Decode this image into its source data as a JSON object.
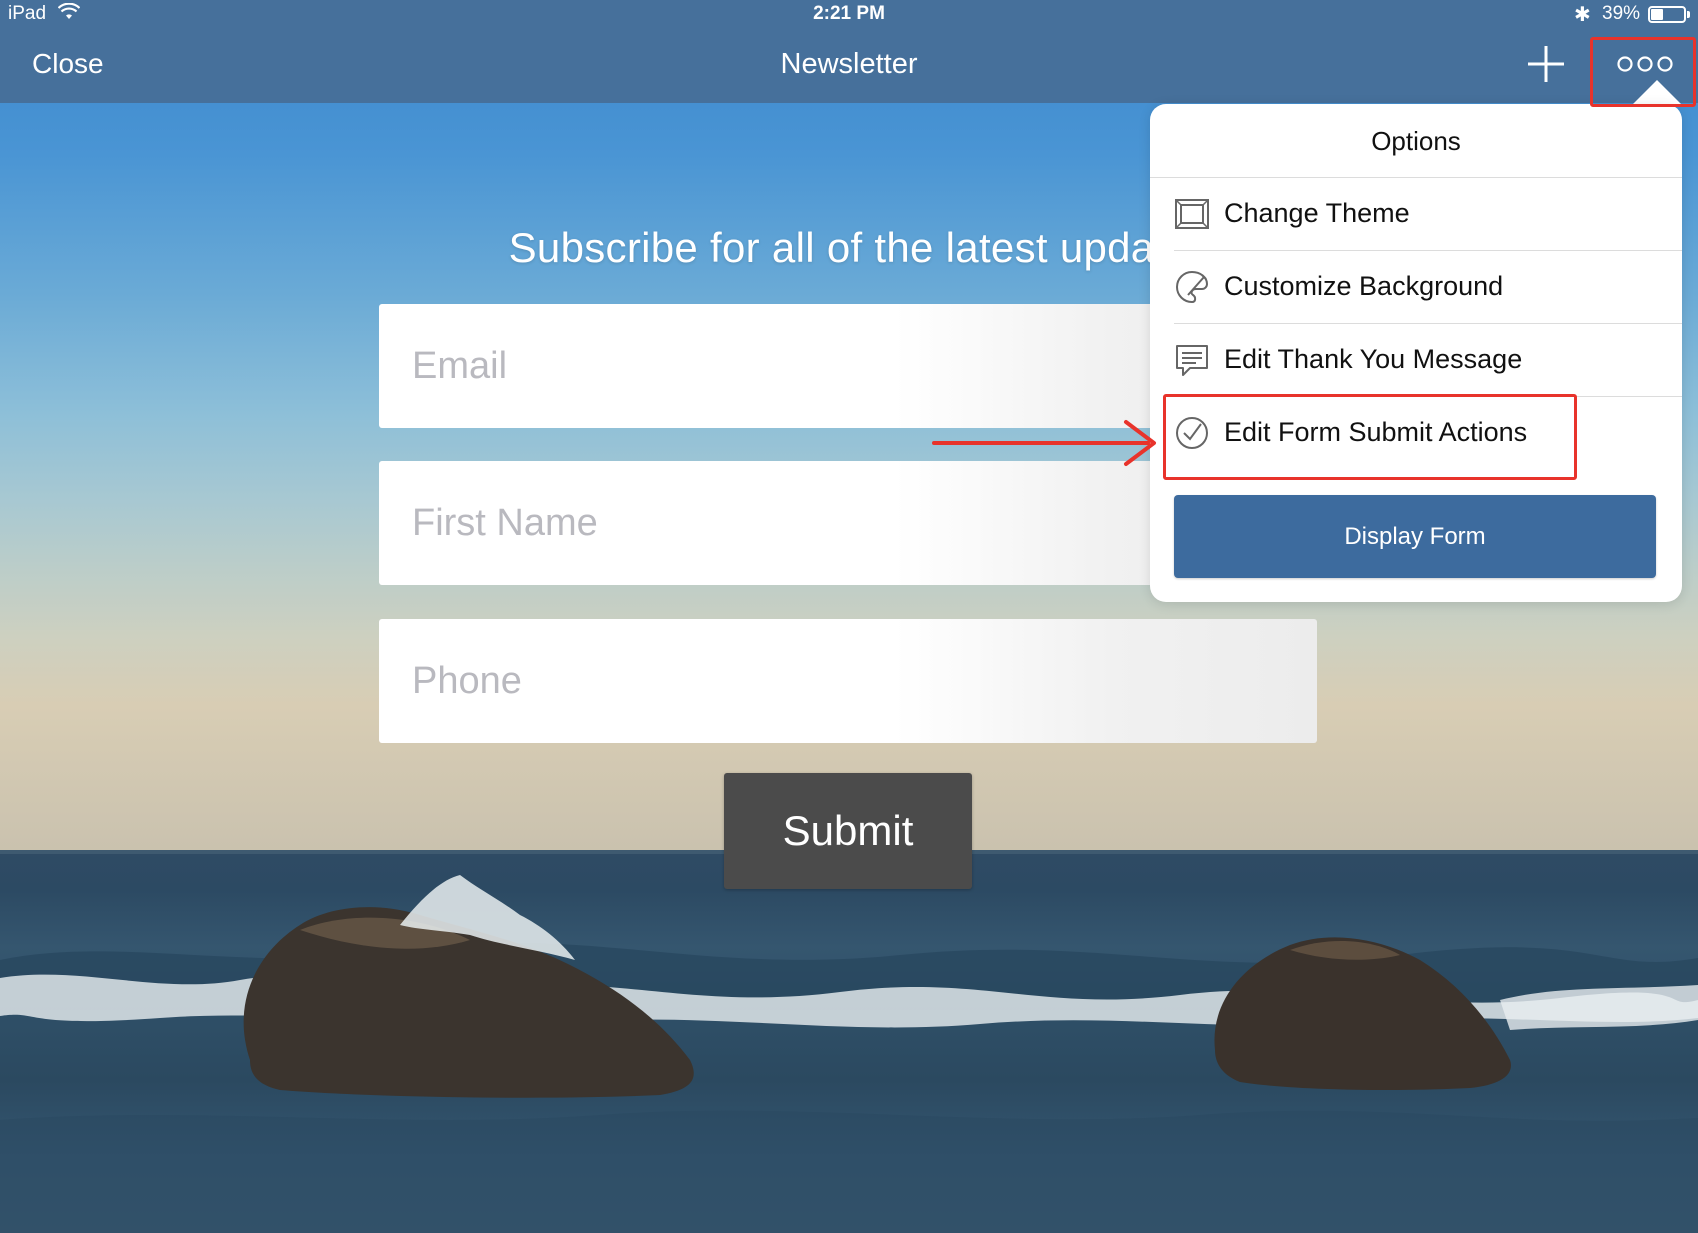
{
  "status_bar": {
    "device": "iPad",
    "time": "2:21 PM",
    "battery_percent": "39%",
    "battery_level": 0.39,
    "icons": [
      "wifi-icon",
      "bluetooth-icon",
      "battery-icon"
    ]
  },
  "nav": {
    "close_label": "Close",
    "title": "Newsletter",
    "add_icon": "plus-icon",
    "more_icon": "more-options-icon"
  },
  "form": {
    "heading": "Subscribe for all of the latest updates",
    "fields": [
      {
        "placeholder": "Email"
      },
      {
        "placeholder": "First Name"
      },
      {
        "placeholder": "Phone"
      }
    ],
    "submit_label": "Submit"
  },
  "options_popover": {
    "title": "Options",
    "items": [
      {
        "label": "Change Theme",
        "icon": "theme-frame-icon"
      },
      {
        "label": "Customize Background",
        "icon": "palette-brush-icon"
      },
      {
        "label": "Edit Thank You Message",
        "icon": "message-bubble-icon"
      },
      {
        "label": "Edit Form Submit Actions",
        "icon": "check-circle-icon"
      }
    ],
    "display_form_label": "Display Form"
  },
  "colors": {
    "nav_bar": "#46709b",
    "display_form_button": "#3d6b9e",
    "submit_button": "#4b4b4b",
    "annotation_red": "#e8332b"
  }
}
